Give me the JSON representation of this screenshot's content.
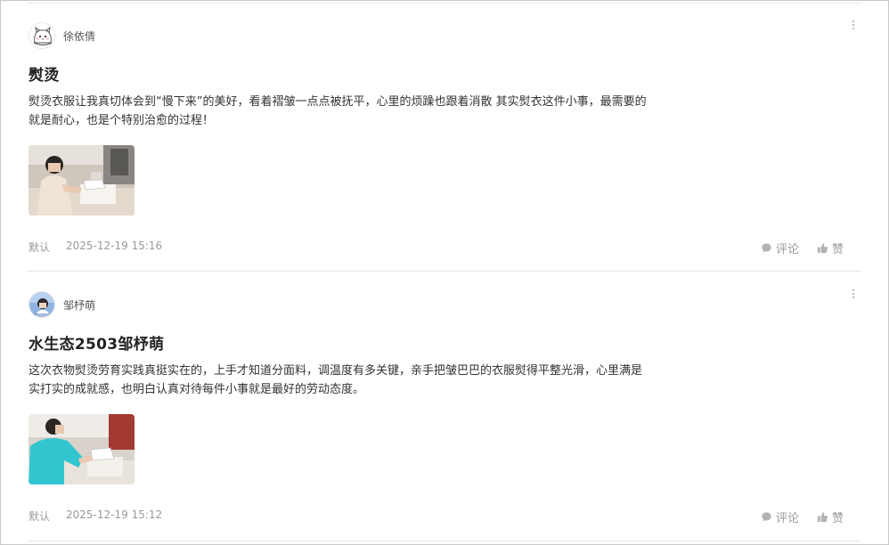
{
  "posts": [
    {
      "author": "徐依倩",
      "avatar_icon": "cartoon-cat-avatar-icon",
      "title": "熨烫",
      "body_lines": [
        "熨烫衣服让我真切体会到“慢下来”的美好，看着褶皱一点点被抚平，心里的烦躁也跟着消散 其实熨衣这件小事，最需要的",
        "就是耐心，也是个特别治愈的过程！"
      ],
      "tag": "默认",
      "date": "2025-12-19 15:16",
      "comment_label": "评论",
      "like_label": "赞"
    },
    {
      "author": "邹杼萌",
      "avatar_icon": "photo-avatar-icon",
      "title": "水生态2503邹杼萌",
      "body_lines": [
        "这次衣物熨烫劳育实践真挺实在的，上手才知道分面料，调温度有多关键，亲手把皱巴巴的衣服熨得平整光滑，心里满是",
        "实打实的成就感，也明白认真对待每件小事就是最好的劳动态度。"
      ],
      "tag": "默认",
      "date": "2025-12-19 15:12",
      "comment_label": "评论",
      "like_label": "赞"
    }
  ],
  "colors": {
    "text": "#333333",
    "meta": "#999999",
    "divider": "#e8e8e8"
  }
}
